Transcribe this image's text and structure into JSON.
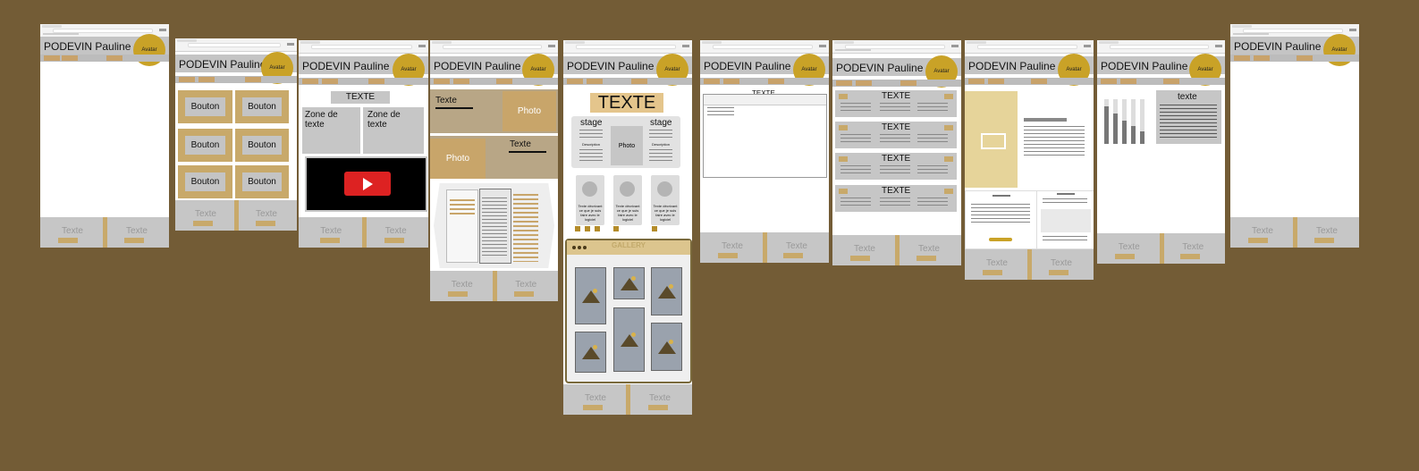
{
  "canvas": {
    "background": "#735c36"
  },
  "colors": {
    "avatar": "#c9a227",
    "tan": "#c8a96a",
    "gray": "#c6c6c6"
  },
  "header": {
    "name": "PODEVIN Pauline",
    "avatar": "Avatar"
  },
  "footer": {
    "text": "Texte",
    "button": "Bouton"
  },
  "nav_label": "Bouton",
  "frame2": {
    "buttons": [
      "Bouton",
      "Bouton",
      "Bouton",
      "Bouton",
      "Bouton",
      "Bouton"
    ]
  },
  "frame3": {
    "title": "TEXTE",
    "zone_left": "Zone de texte",
    "zone_right": "Zone de texte",
    "video_icon": "play-icon"
  },
  "frame4": {
    "text1": "Texte",
    "photo1": "Photo",
    "photo2": "Photo",
    "text2": "Texte"
  },
  "frame5": {
    "title": "TEXTE",
    "stage_left": "stage",
    "stage_right": "stage",
    "photo": "Photo",
    "desc_left": "Description",
    "desc_right": "Description",
    "card_text": [
      "Texte décrivant ce que je suis faire avec le logiciel",
      "Texte décrivant ce que je suis faire avec le logiciel",
      "Texte décrivant ce que je suis faire avec le logiciel"
    ],
    "gallery": "GALLERY"
  },
  "frame6": {
    "title": "TEXTE"
  },
  "frame7": {
    "rows": [
      "TEXTE",
      "TEXTE",
      "TEXTE",
      "TEXTE"
    ]
  },
  "frame9": {
    "text": "texte"
  }
}
